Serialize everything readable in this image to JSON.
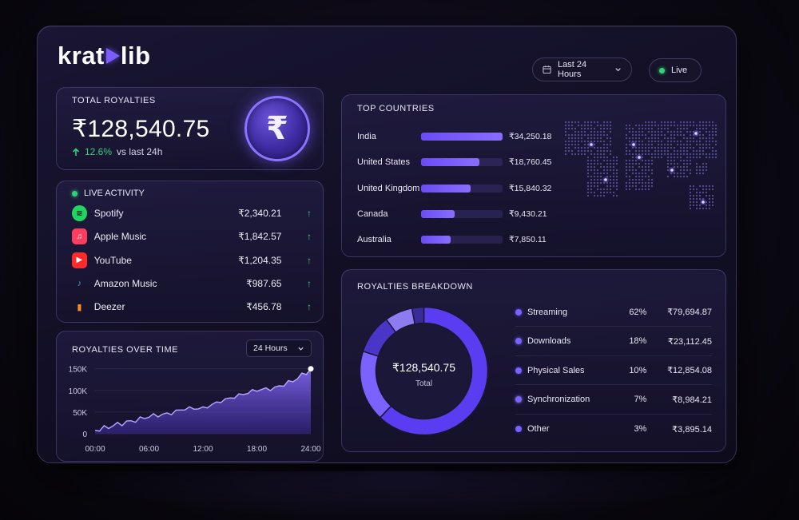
{
  "brand": {
    "logo_left": "krat",
    "logo_right": "lib"
  },
  "header": {
    "range_label": "Last 24 Hours",
    "live_label": "Live"
  },
  "total": {
    "title": "TOTAL ROYALTIES",
    "amount": "₹128,540.75",
    "change_pct": "12.6%",
    "change_text": "vs last 24h",
    "coin_symbol": "₹"
  },
  "live_activity": {
    "title": "LIVE ACTIVITY",
    "items": [
      {
        "name": "Spotify",
        "amount": "₹2,340.21",
        "icon": "spotify-icon",
        "color": "#1ed760"
      },
      {
        "name": "Apple Music",
        "amount": "₹1,842.57",
        "icon": "apple-music-icon",
        "color": "#fa3e5f"
      },
      {
        "name": "YouTube",
        "amount": "₹1,204.35",
        "icon": "youtube-icon",
        "color": "#ff2a2a"
      },
      {
        "name": "Amazon Music",
        "amount": "₹987.65",
        "icon": "amazon-music-icon",
        "color": "#2fa7d6"
      },
      {
        "name": "Deezer",
        "amount": "₹456.78",
        "icon": "deezer-icon",
        "color": "#ff8a1f"
      }
    ]
  },
  "over_time": {
    "title": "ROYALTIES OVER TIME",
    "select_label": "24 Hours"
  },
  "chart_data": {
    "type": "area",
    "x": [
      "00:00",
      "02:00",
      "04:00",
      "06:00",
      "08:00",
      "10:00",
      "12:00",
      "14:00",
      "16:00",
      "18:00",
      "20:00",
      "22:00",
      "24:00"
    ],
    "x_ticks": [
      "00:00",
      "06:00",
      "12:00",
      "18:00",
      "24:00"
    ],
    "values": [
      8000,
      18000,
      30000,
      38000,
      48000,
      55000,
      62000,
      72000,
      92000,
      98000,
      108000,
      120000,
      150000
    ],
    "y_ticks": [
      "0",
      "50K",
      "100K",
      "150K"
    ],
    "ylim": [
      0,
      155000
    ],
    "color": "#7a5cff"
  },
  "countries": {
    "title": "TOP COUNTRIES",
    "items": [
      {
        "name": "India",
        "value": "₹34,250.18",
        "share": 1.0
      },
      {
        "name": "United States",
        "value": "₹18,760.45",
        "share": 0.72
      },
      {
        "name": "United Kingdom",
        "value": "₹15,840.32",
        "share": 0.61
      },
      {
        "name": "Canada",
        "value": "₹9,430.21",
        "share": 0.41
      },
      {
        "name": "Australia",
        "value": "₹7,850.11",
        "share": 0.36
      }
    ]
  },
  "breakdown": {
    "title": "ROYALTIES BREAKDOWN",
    "total_value": "₹128,540.75",
    "total_label": "Total",
    "items": [
      {
        "name": "Streaming",
        "pct": "62%",
        "value": "₹79,694.87",
        "share": 62,
        "color": "#5a3df0"
      },
      {
        "name": "Downloads",
        "pct": "18%",
        "value": "₹23,112.45",
        "share": 18,
        "color": "#7b62ff"
      },
      {
        "name": "Physical Sales",
        "pct": "10%",
        "value": "₹12,854.08",
        "share": 10,
        "color": "#4a36c6"
      },
      {
        "name": "Synchronization",
        "pct": "7%",
        "value": "₹8,984.21",
        "share": 7,
        "color": "#8d7bf0"
      },
      {
        "name": "Other",
        "pct": "3%",
        "value": "₹3,895.14",
        "share": 3,
        "color": "#3a2b9a"
      }
    ]
  }
}
